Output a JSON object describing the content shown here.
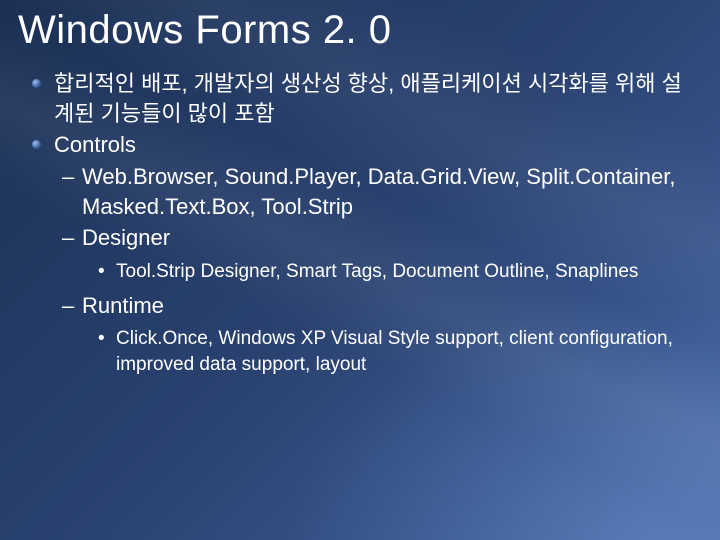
{
  "title": "Windows Forms 2. 0",
  "bullets": [
    "합리적인 배포, 개발자의 생산성 향상, 애플리케이션 시각화를 위해 설계된 기능들이 많이 포함",
    "Controls"
  ],
  "controls": {
    "sub": [
      "Web.Browser, Sound.Player, Data.Grid.View, Split.Container, Masked.Text.Box, Tool.Strip",
      "Designer",
      "Runtime"
    ],
    "designer_detail": "Tool.Strip Designer, Smart Tags, Document Outline, Snaplines",
    "runtime_detail": "Click.Once, Windows XP Visual Style support, client configuration, improved data support, layout"
  }
}
